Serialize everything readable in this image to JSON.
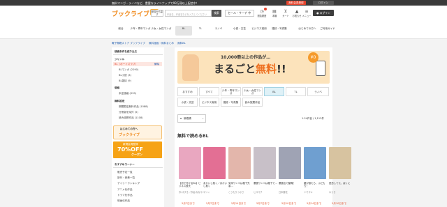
{
  "topbar": {
    "message": "無料マンガ・ラノベなど、豊富なラインナップで99万冊以上配信中！",
    "promo_label": "無料会員登録",
    "login_label": "ログイン"
  },
  "header": {
    "logo": "ブックライブ",
    "select_label": "総合から探す",
    "search_placeholder": "作品名、作者名などを入力してください",
    "search_button": "検索",
    "sale_label": "セール・サーチ 中",
    "icons": [
      {
        "name": "history-icon",
        "glyph": "◷",
        "label": "閲覧履歴"
      },
      {
        "name": "bookshelf-icon",
        "glyph": "▤",
        "label": "本棚"
      },
      {
        "name": "cart-icon",
        "glyph": "⊻",
        "label": "カート"
      },
      {
        "name": "bell-icon",
        "glyph": "▲",
        "label": "お知らせ"
      },
      {
        "name": "menu-icon",
        "glyph": "≡",
        "label": "メニュー"
      },
      {
        "name": "user-icon",
        "glyph": "●",
        "label": "ログイン"
      }
    ],
    "categories": [
      "総合",
      "少年・青年マンガ",
      "少女・女性マンガ",
      "BL",
      "TL",
      "ラノベ",
      "小説・文芸",
      "ビジネス実用",
      "雑誌・写真集",
      "はじめての方へ",
      "ご利用ガイド"
    ]
  },
  "breadcrumb": [
    "電子書籍ストア ブックライブ",
    "無料漫画・無料まとめ",
    "無料BL"
  ],
  "sidebar": {
    "group_title": "検索条件を絞り込む",
    "label_genre": "ジャンル",
    "item_selected": "BL（ボーイズラブ）",
    "clear": "解除",
    "subitems": [
      "BLマンガ (2290)",
      "BL小説 (3)",
      "BL雑誌 (9)"
    ],
    "label_price": "価格",
    "price_item": "未定価格 (999)",
    "label_other": "無料設定",
    "other_items": [
      "期間限定無料作品 (1088)",
      "分冊版を除外 (5)",
      "読み放題作品 (1108)"
    ],
    "banner1_text": "はじめての方へ",
    "banner1_sub": "ブックライブ",
    "banner2_top": "新規会員登録",
    "banner2_big": "70%OFF",
    "banner2_sub": "クーポン",
    "recommend_title": "おすすめコーナー",
    "recommend_items": [
      "販売予定一覧",
      "新刊・続巻一覧",
      "デイリーランキング",
      "アニメ化作品",
      "ドラマ化作品",
      "映画化作品"
    ]
  },
  "banner": {
    "line1": "10,000冊以上の作品が…",
    "line2_a": "まるごと",
    "line2_b": "無料",
    "line2_c": "!!",
    "badge": "¥0"
  },
  "tabs": {
    "row1": [
      "おすすめ",
      "すべて",
      "少年・青年マンガ",
      "少女・女性マンガ",
      "BL",
      "TL",
      "ラノベ"
    ],
    "row2": [
      "小説・文芸",
      "ビジネス実用",
      "雑誌・写真集",
      "読み放題作品"
    ]
  },
  "list": {
    "sort_label": "新着順",
    "count": "1-24件目 / 1,113件",
    "section_title": "無料で読めるBL"
  },
  "books": [
    {
      "title": "【初で付けるBL】ビジネス彼氏",
      "author": "作:ほすき／作画:ななや…",
      "date": "5月7日まで",
      "color": "#e9a7c0"
    },
    {
      "title": "あかいし抱く／あかいし抱く",
      "author": "マリィ",
      "date": "5月7日まで",
      "color": "#e36f94"
    },
    {
      "title": "気持ワンコは格下先輩…",
      "author": "こうもりつかさ",
      "date": "5月14日まで",
      "color": "#e3b6ab"
    },
    {
      "title": "悪魔ワンコは格下で…",
      "author": "ヒロマチ",
      "date": "5月7日まで",
      "color": "#c8c0c8"
    },
    {
      "title": "悪魔出て聖職！",
      "author": "日本藤花",
      "date": "5月10日まで",
      "color": "#9fa3b4"
    },
    {
      "title": "鍵が欲たら、ふだもち！",
      "author": "ヤマザキ",
      "date": "5月14日まで",
      "color": "#6f9fd0"
    },
    {
      "title": "夏恋してた、ぼくに",
      "author": "ゆうき",
      "date": "5月10日まで",
      "color": "#d7c3a0"
    }
  ]
}
